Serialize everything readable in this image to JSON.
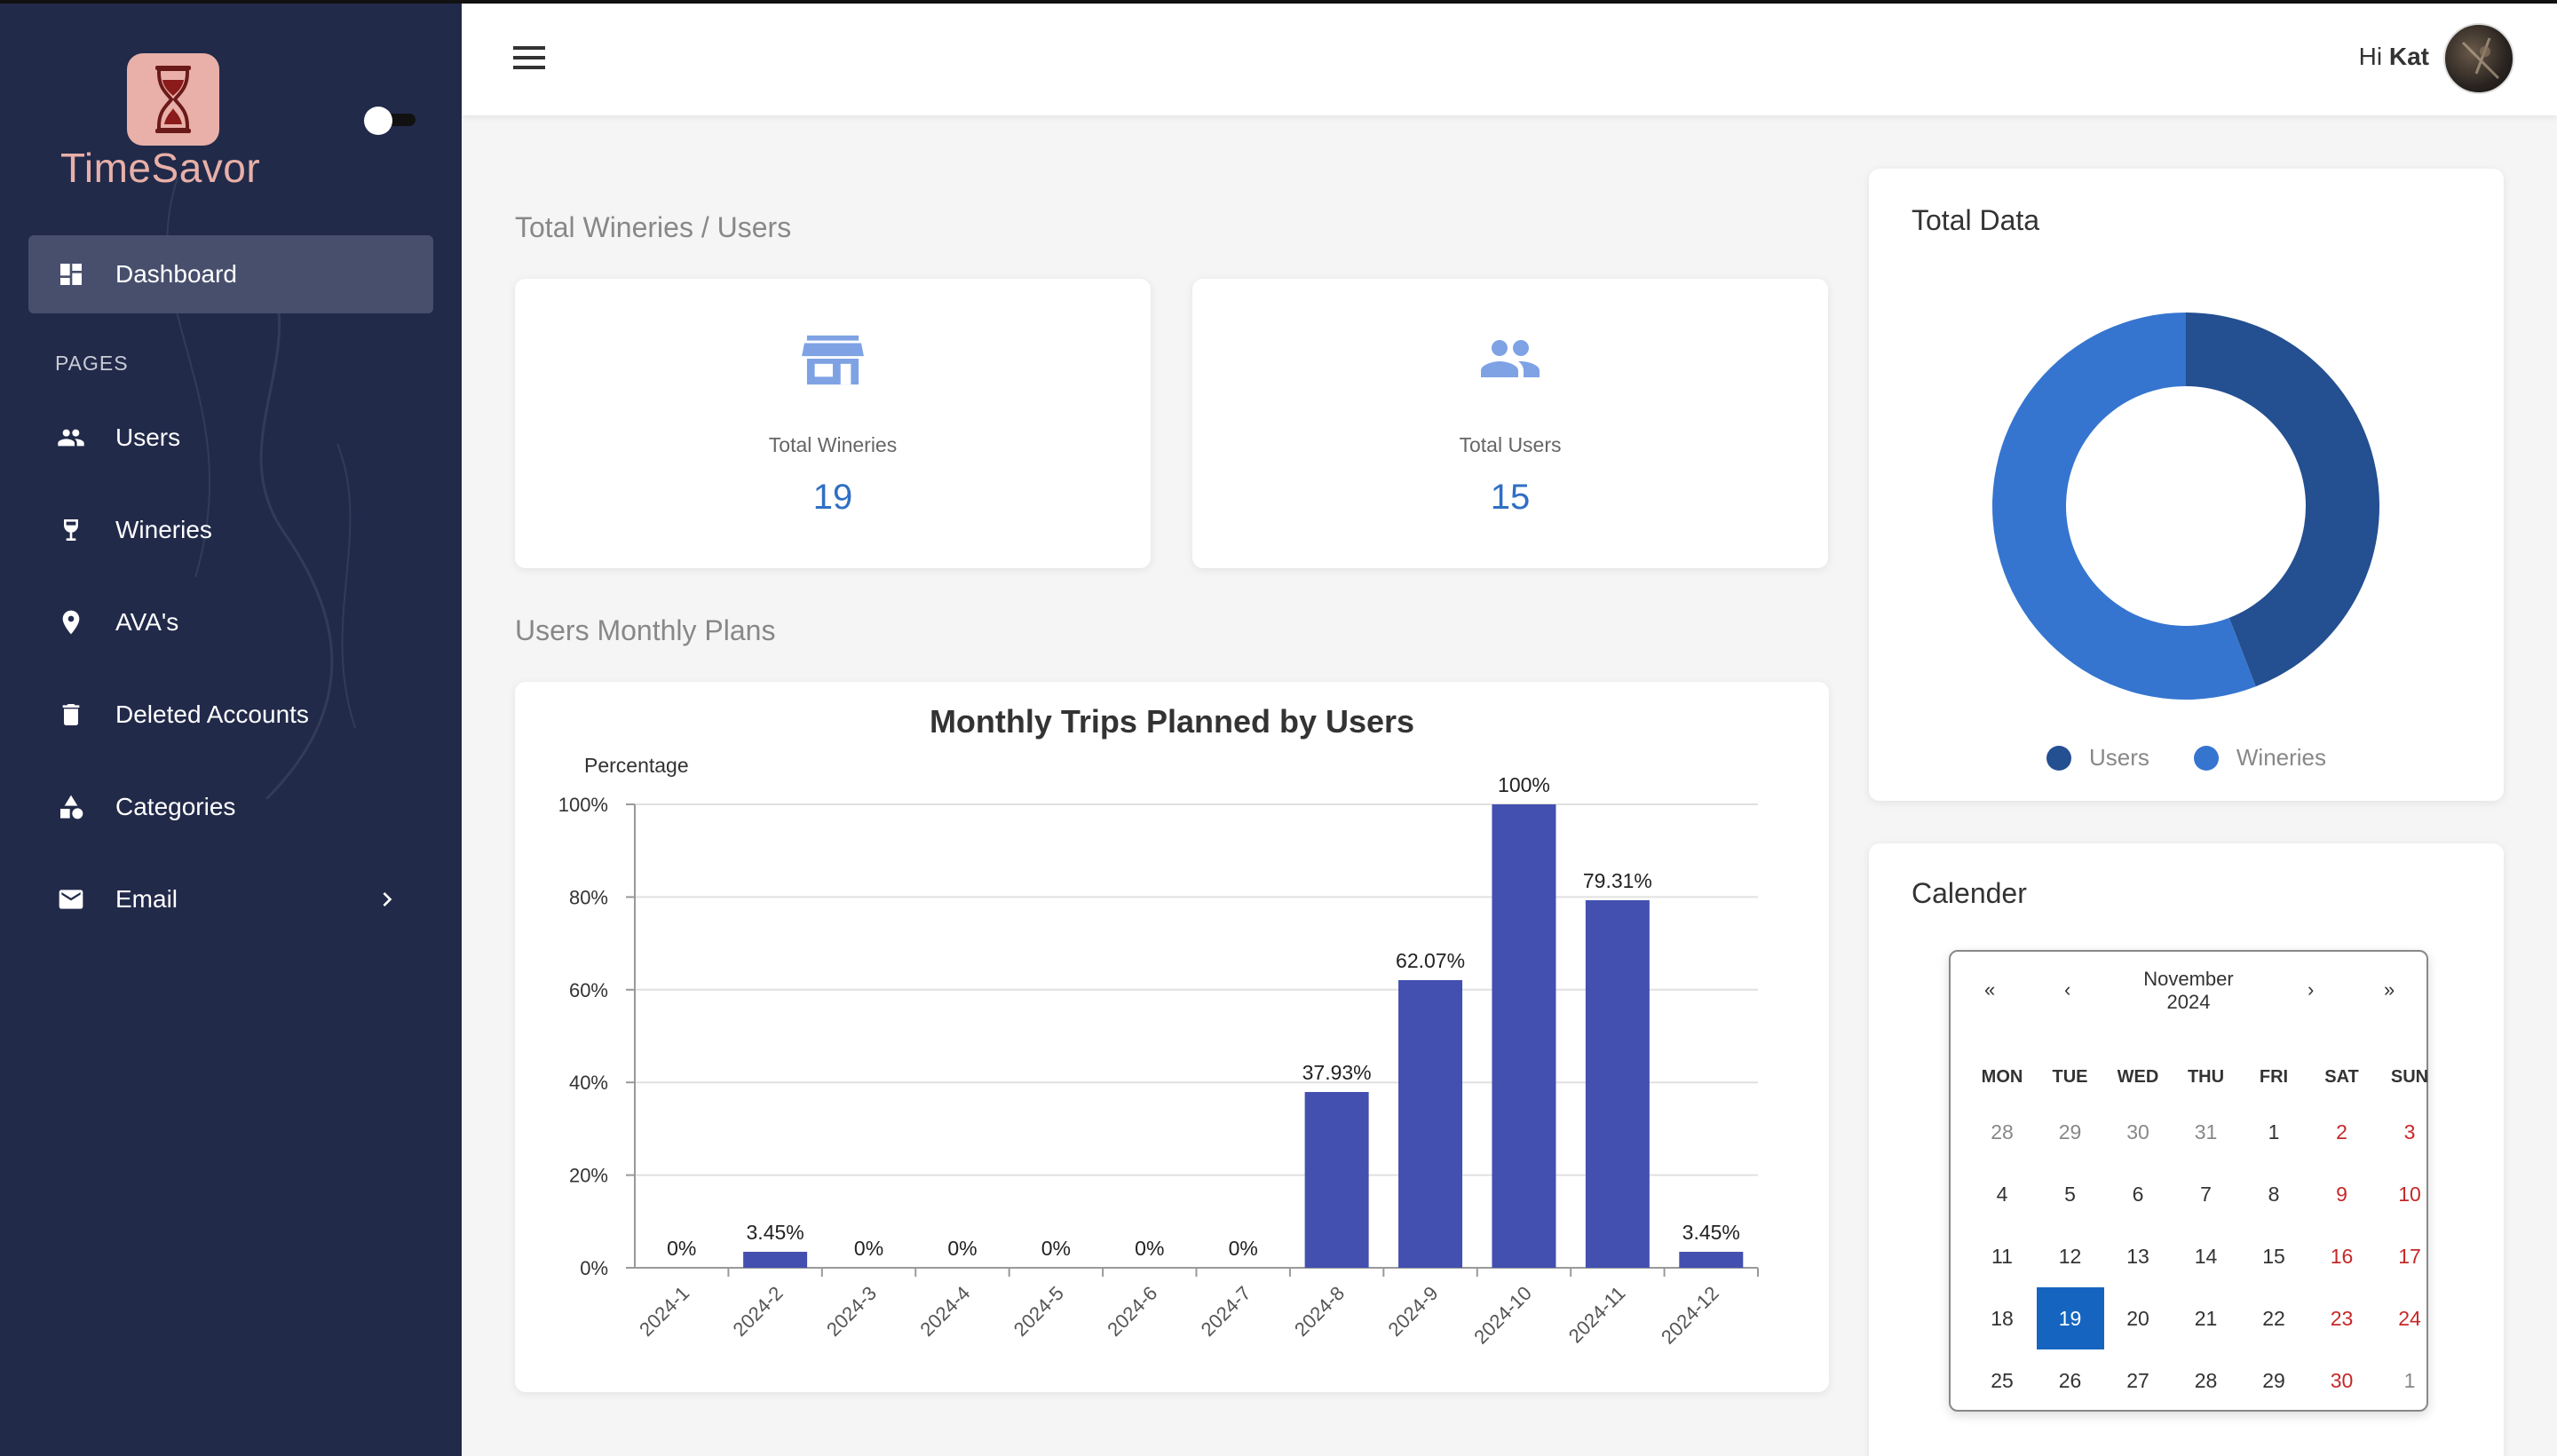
{
  "app": {
    "name": "TimeSavor",
    "logo_icon": "wine-hourglass-icon"
  },
  "sidebar": {
    "pages_label": "PAGES",
    "items": [
      {
        "label": "Dashboard",
        "icon": "dashboard-icon",
        "active": true
      },
      {
        "label": "Users",
        "icon": "people-icon"
      },
      {
        "label": "Wineries",
        "icon": "wine-glass-icon"
      },
      {
        "label": "AVA's",
        "icon": "location-pin-icon"
      },
      {
        "label": "Deleted Accounts",
        "icon": "trash-icon"
      },
      {
        "label": "Categories",
        "icon": "shapes-icon"
      },
      {
        "label": "Email",
        "icon": "mail-icon",
        "has_submenu": true
      }
    ]
  },
  "header": {
    "greeting": "Hi",
    "user_name": "Kat"
  },
  "totals_section": {
    "title": "Total Wineries / Users",
    "wineries": {
      "label": "Total Wineries",
      "value": "19",
      "icon": "store-icon"
    },
    "users": {
      "label": "Total Users",
      "value": "15",
      "icon": "people-icon"
    }
  },
  "plans_section": {
    "title": "Users Monthly Plans"
  },
  "chart_data": [
    {
      "type": "bar",
      "title": "Monthly Trips Planned by Users",
      "ylabel": "Percentage",
      "xlabel": "",
      "categories": [
        "2024-1",
        "2024-2",
        "2024-3",
        "2024-4",
        "2024-5",
        "2024-6",
        "2024-7",
        "2024-8",
        "2024-9",
        "2024-10",
        "2024-11",
        "2024-12"
      ],
      "values": [
        0,
        3.45,
        0,
        0,
        0,
        0,
        0,
        37.93,
        62.07,
        100,
        79.31,
        3.45
      ],
      "data_labels": [
        "0%",
        "3.45%",
        "0%",
        "0%",
        "0%",
        "0%",
        "0%",
        "37.93%",
        "62.07%",
        "100%",
        "79.31%",
        "3.45%"
      ],
      "yticks": [
        "0%",
        "20%",
        "40%",
        "60%",
        "80%",
        "100%"
      ],
      "ylim": [
        0,
        100
      ],
      "grid": true,
      "color": "#4350b0"
    },
    {
      "type": "pie",
      "title": "Total Data",
      "labels": [
        "Users",
        "Wineries"
      ],
      "values": [
        15,
        19
      ],
      "colors": [
        "#244f91",
        "#3575cf"
      ],
      "legend": "bottom"
    }
  ],
  "calendar": {
    "title": "Calender",
    "month_label": "November",
    "year_label": "2024",
    "nav": {
      "prev_year": "«",
      "prev": "‹",
      "next": "›",
      "next_year": "»"
    },
    "weekdays": [
      "MON",
      "TUE",
      "WED",
      "THU",
      "FRI",
      "SAT",
      "SUN"
    ],
    "weeks": [
      [
        "28",
        "29",
        "30",
        "31",
        "1",
        "2",
        "3"
      ],
      [
        "4",
        "5",
        "6",
        "7",
        "8",
        "9",
        "10"
      ],
      [
        "11",
        "12",
        "13",
        "14",
        "15",
        "16",
        "17"
      ],
      [
        "18",
        "19",
        "20",
        "21",
        "22",
        "23",
        "24"
      ],
      [
        "25",
        "26",
        "27",
        "28",
        "29",
        "30",
        "1"
      ]
    ],
    "selected": "19",
    "colors": {
      "selected": "#1565c0",
      "weekend": "#c62828"
    }
  }
}
